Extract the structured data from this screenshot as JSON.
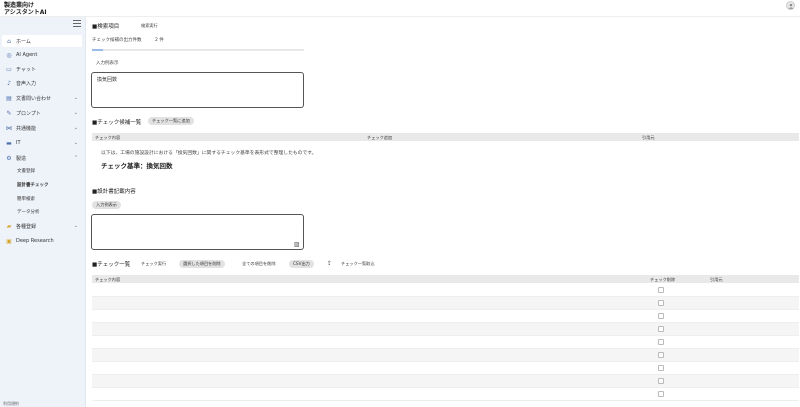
{
  "header": {
    "brand_line1": "製造業向け",
    "brand_line2": "アシスタントAI"
  },
  "sidebar": {
    "items": [
      {
        "label": "ホーム",
        "icon": "home-icon"
      },
      {
        "label": "AI Agent",
        "icon": "robot-icon"
      },
      {
        "label": "チャット",
        "icon": "chat-icon"
      },
      {
        "label": "音声入力",
        "icon": "mic-icon"
      },
      {
        "label": "文書問い合わせ",
        "icon": "document-icon"
      },
      {
        "label": "プロンプト",
        "icon": "pen-icon"
      },
      {
        "label": "共通機能",
        "icon": "share-icon"
      },
      {
        "label": "IT",
        "icon": "monitor-icon"
      },
      {
        "label": "製造",
        "icon": "factory-icon"
      },
      {
        "label": "各種登録",
        "icon": "folder-icon"
      },
      {
        "label": "Deep Research",
        "icon": "book-icon"
      }
    ],
    "sub_items": [
      "文書登録",
      "設計書チェック",
      "簡単検索",
      "データ分析"
    ],
    "footer": "利用規約"
  },
  "search_section": {
    "title": "■検索項目",
    "run_button": "検索実行",
    "output_count_label": "チェック候補の出力件数",
    "output_count_value": "2 件",
    "progress": 0.05,
    "input_example_label": "入力例表示",
    "input_value": "換気回数"
  },
  "candidates_section": {
    "title": "■チェック候補一覧",
    "add_button": "チェック一覧に追加",
    "columns": [
      "チェック内容",
      "チェック追加",
      "引用元"
    ],
    "description": "以下は、工場の施設設計における「換気回数」に関するチェック基準を表形式で整理したものです。",
    "criterion": "チェック基準：換気回数"
  },
  "design_section": {
    "title": "■設計書記載内容",
    "input_example_button": "入力例表示"
  },
  "checklist_section": {
    "title": "■チェック一覧",
    "buttons": [
      "チェック実行",
      "選択した項目を削除",
      "全ての項目を削除",
      "CSV出力",
      "チェック一覧取込"
    ],
    "columns": [
      "チェック内容",
      "チェック削除",
      "引用元"
    ]
  }
}
